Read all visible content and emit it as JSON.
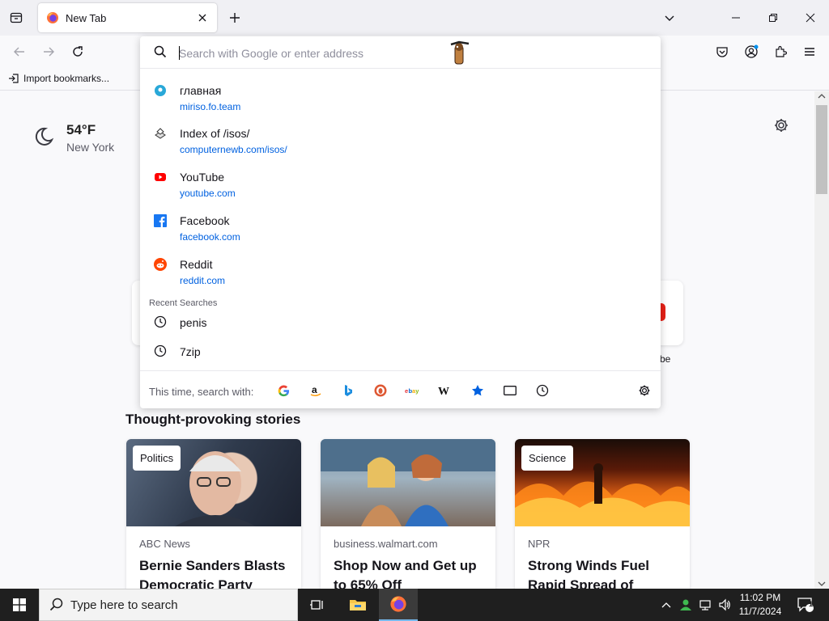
{
  "browser": {
    "tab": {
      "title": "New Tab"
    },
    "bookmarks": {
      "import_label": "Import bookmarks..."
    }
  },
  "urlbar": {
    "placeholder": "Search with Google or enter address",
    "suggestions": [
      {
        "title": "главная",
        "url": "miriso.fo.team",
        "icon": "site-circle-icon"
      },
      {
        "title": "Index of /isos/",
        "url": "computernewb.com/isos/",
        "icon": "site-favicon-icon"
      },
      {
        "title": "YouTube",
        "url": "youtube.com",
        "icon": "youtube-icon"
      },
      {
        "title": "Facebook",
        "url": "facebook.com",
        "icon": "facebook-icon"
      },
      {
        "title": "Reddit",
        "url": "reddit.com",
        "icon": "reddit-icon"
      }
    ],
    "recent_header": "Recent Searches",
    "recent_searches": [
      "penis",
      "7zip"
    ],
    "engine_label": "This time, search with:",
    "engines": [
      "google",
      "amazon",
      "bing",
      "duckduckgo",
      "ebay",
      "wikipedia",
      "bookmarks",
      "tabs",
      "history"
    ]
  },
  "newtab": {
    "weather": {
      "temp": "54°F",
      "city": "New York"
    },
    "shortcut_peek_label": "be",
    "stories_title": "Thought-provoking stories",
    "stories": [
      {
        "tag": "Politics",
        "source": "ABC News",
        "headline": "Bernie Sanders Blasts Democratic Party"
      },
      {
        "tag": "",
        "source": "business.walmart.com",
        "headline": "Shop Now and Get up to 65% Off"
      },
      {
        "tag": "Science",
        "source": "NPR",
        "headline": "Strong Winds Fuel Rapid Spread of"
      }
    ]
  },
  "taskbar": {
    "search_placeholder": "Type here to search",
    "time": "11:02 PM",
    "date": "11/7/2024",
    "notification_count": "1"
  },
  "colors": {
    "link": "#0061e0",
    "taskbar": "#1f1f1f",
    "accent": "#0061e0"
  }
}
